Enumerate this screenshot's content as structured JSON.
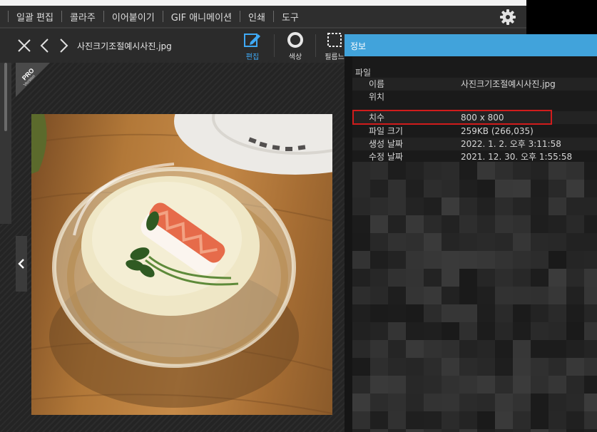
{
  "menubar": {
    "items": [
      "일괄 편집",
      "콜라주",
      "이어붙이기",
      "GIF 애니메이션",
      "인쇄",
      "도구"
    ],
    "settings_icon": "gear-icon"
  },
  "toolbar": {
    "filename": "사진크기조절예시사진.jpg",
    "tools": [
      {
        "label": "편집",
        "icon": "edit-icon",
        "active": true
      },
      {
        "label": "색상",
        "icon": "color-circle-icon",
        "active": false
      },
      {
        "label": "필름느",
        "icon": "film-frame-icon",
        "active": false
      }
    ],
    "accent_color": "#3fa9f5"
  },
  "viewer": {
    "badge_line1": "PRO",
    "badge_line2": "Version"
  },
  "info_panel": {
    "title": "정보",
    "header_color": "#41a3db",
    "section": "파일",
    "rows": [
      {
        "label": "이름",
        "value": "사진크기조절예시사진.jpg"
      },
      {
        "label": "위치",
        "value": ""
      },
      {
        "label": "치수",
        "value": "800 x 800",
        "highlighted": true
      },
      {
        "label": "파일 크기",
        "value": "259KB (266,035)"
      },
      {
        "label": "생성 날짜",
        "value": "2022. 1. 2. 오후 3:11:58"
      },
      {
        "label": "수정 날짜",
        "value": "2021. 12. 30. 오후 1:55:58"
      }
    ],
    "highlight_color": "#d11c1c"
  }
}
